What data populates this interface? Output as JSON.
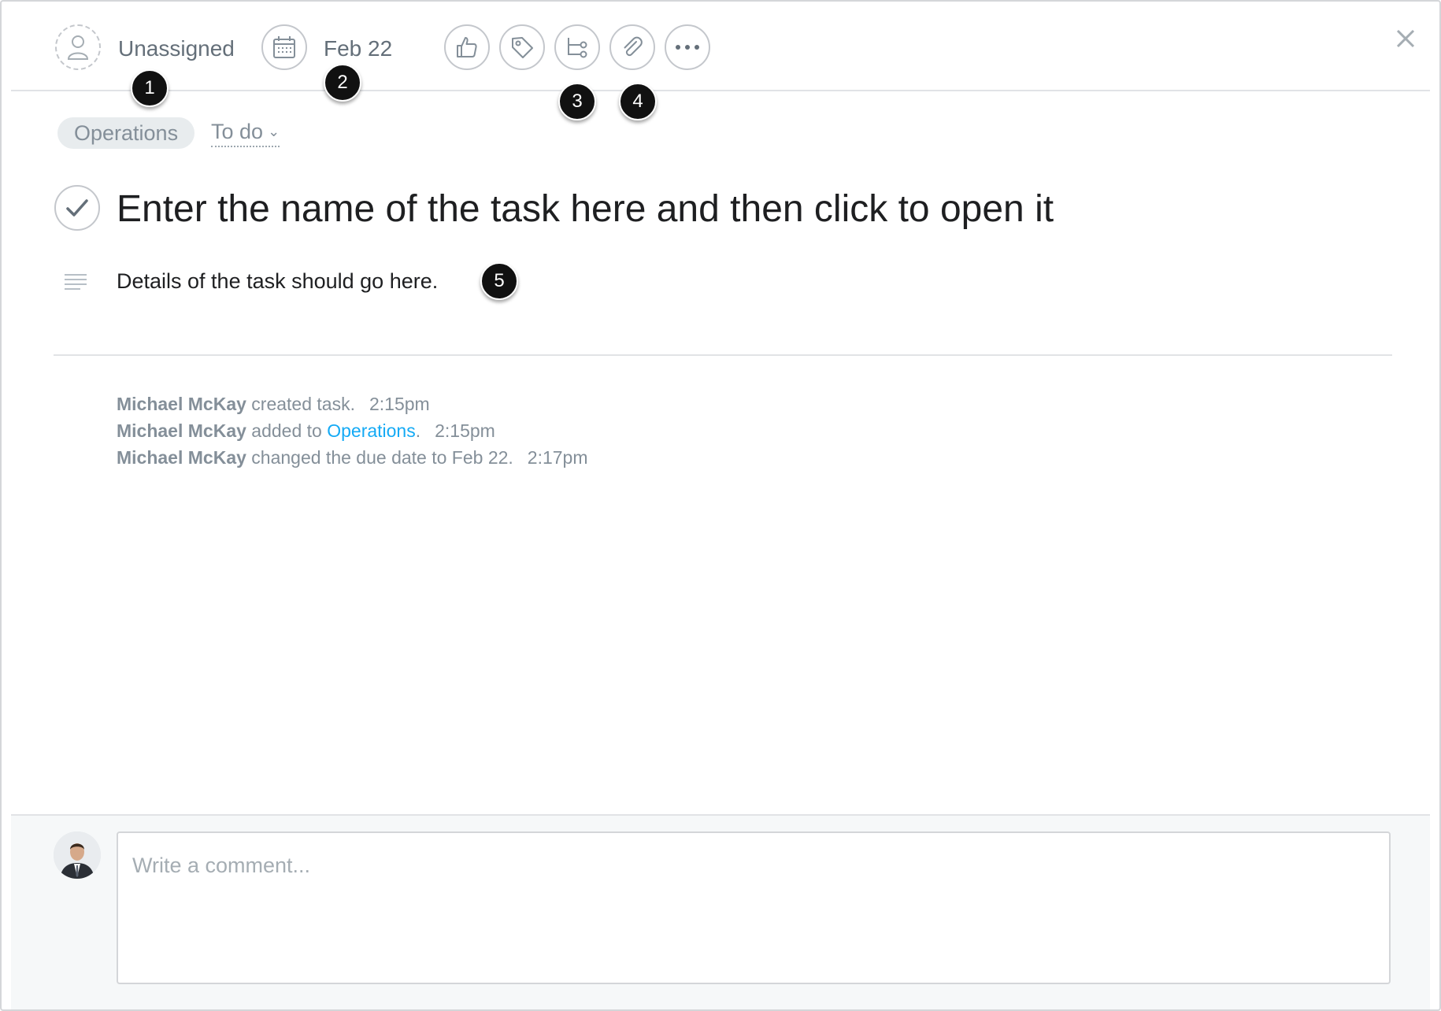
{
  "toolbar": {
    "assignee_label": "Unassigned",
    "due_date_label": "Feb 22",
    "actions": [
      "thumbs-up-icon",
      "tag-icon",
      "subtask-icon",
      "paperclip-icon",
      "more-icon"
    ],
    "close_icon": "close-icon"
  },
  "callouts": [
    "1",
    "2",
    "3",
    "4",
    "5"
  ],
  "project": {
    "name": "Operations",
    "section": "To do"
  },
  "task": {
    "title": "Enter the name of the task here and then click to open it",
    "description": "Details of the task should go here."
  },
  "activity": [
    {
      "actor": "Michael McKay",
      "text_before": " created task.",
      "link": "",
      "text_after": "",
      "time": "2:15pm"
    },
    {
      "actor": "Michael McKay",
      "text_before": " added to ",
      "link": "Operations",
      "text_after": ".",
      "time": "2:15pm"
    },
    {
      "actor": "Michael McKay",
      "text_before": " changed the due date to Feb 22.",
      "link": "",
      "text_after": "",
      "time": "2:17pm"
    }
  ],
  "comment": {
    "placeholder": "Write a comment..."
  },
  "colors": {
    "link": "#14aaf5",
    "muted_text": "#848f99",
    "badge": "#111111",
    "pill_bg": "#e8ecee"
  }
}
